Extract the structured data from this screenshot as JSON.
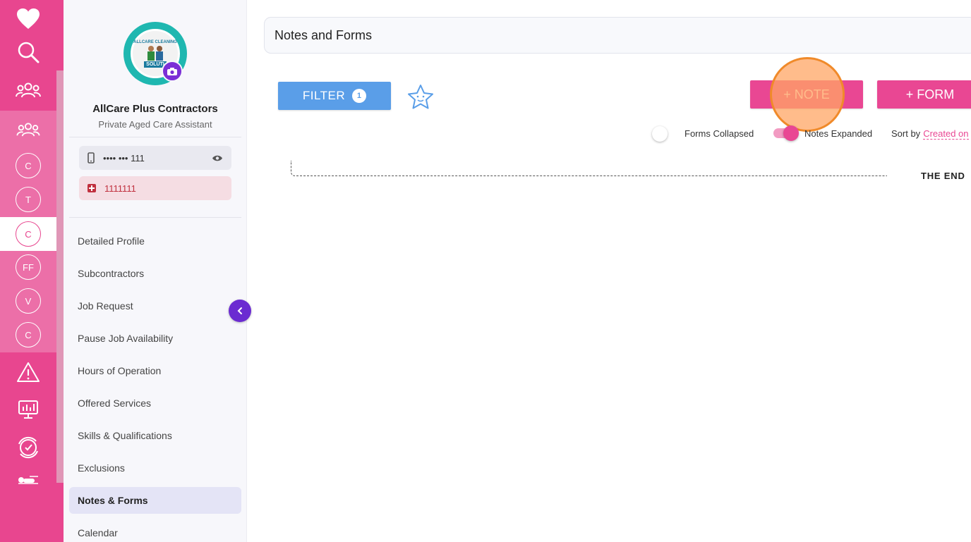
{
  "rail": {
    "items": [
      {
        "name": "heart-icon",
        "label": ""
      },
      {
        "name": "search-icon",
        "label": ""
      },
      {
        "name": "group-icon",
        "label": ""
      },
      {
        "name": "group-icon-2",
        "label": ""
      }
    ],
    "circles": [
      "C",
      "T",
      "C",
      "FF",
      "V",
      "C"
    ],
    "active_circle_index": 2
  },
  "profile": {
    "name": "AllCare Plus Contractors",
    "role": "Private Aged Care Assistant",
    "avatar_text_top": "ALLCARE CLEANING",
    "avatar_text_bottom": "SOLUTI",
    "phone": "•••• ••• 111",
    "ndis": "1111111"
  },
  "menu": [
    {
      "label": "Detailed Profile"
    },
    {
      "label": "Subcontractors"
    },
    {
      "label": "Job Request"
    },
    {
      "label": "Pause Job Availability"
    },
    {
      "label": "Hours of Operation"
    },
    {
      "label": "Offered Services"
    },
    {
      "label": "Skills & Qualifications"
    },
    {
      "label": "Exclusions"
    },
    {
      "label": "Notes & Forms",
      "active": true
    },
    {
      "label": "Calendar"
    }
  ],
  "header": {
    "title": "Notes and Forms"
  },
  "toolbar": {
    "filter_label": "FILTER",
    "filter_count": "1",
    "note_label": "+ NOTE",
    "form_label": "+ FORM"
  },
  "toggles": {
    "forms_label": "Forms Collapsed",
    "forms_on": false,
    "notes_label": "Notes Expanded",
    "notes_on": true
  },
  "sort": {
    "label": "Sort by",
    "value": "Created on"
  },
  "timeline": {
    "end_label": "THE END"
  },
  "colors": {
    "brand_pink": "#e8468f",
    "filter_blue": "#5a9ee8",
    "purple": "#6b2bd1",
    "highlight_orange": "#f08a2a"
  }
}
